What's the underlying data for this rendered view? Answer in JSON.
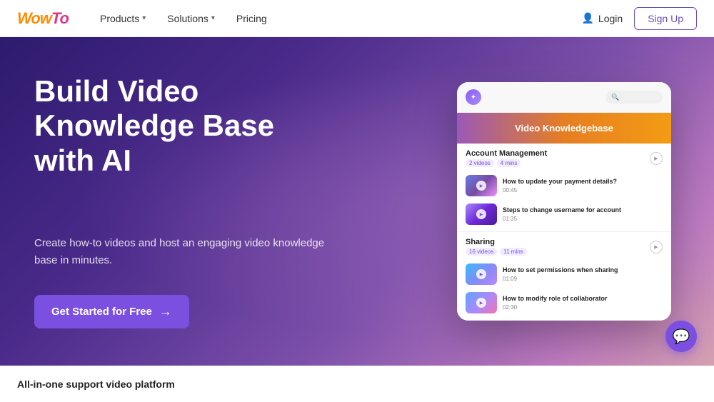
{
  "navbar": {
    "logo_text": "WowTo",
    "products_label": "Products",
    "solutions_label": "Solutions",
    "pricing_label": "Pricing",
    "login_label": "Login",
    "signup_label": "Sign Up"
  },
  "hero": {
    "title": "Build Video Knowledge Base with AI",
    "subtitle": "Create how-to videos and host an engaging video knowledge base in minutes.",
    "cta_label": "Get Started for Free"
  },
  "mockup": {
    "header_title": "Video Knowledgebase",
    "section1": {
      "title": "Account Management",
      "badge1": "2 videos",
      "badge2": "4 mins",
      "item1_title": "How to update your payment details?",
      "item1_duration": "00:45",
      "item2_title": "Steps to change username for account",
      "item2_duration": "01:35"
    },
    "section2": {
      "title": "Sharing",
      "badge1": "16 videos",
      "badge2": "11 mins",
      "item1_title": "How to set permissions when sharing",
      "item1_duration": "01:09",
      "item2_title": "How to modify role of collaborator",
      "item2_duration": "02:30"
    }
  },
  "bottom": {
    "section_title": "All-in-one support video platform"
  }
}
